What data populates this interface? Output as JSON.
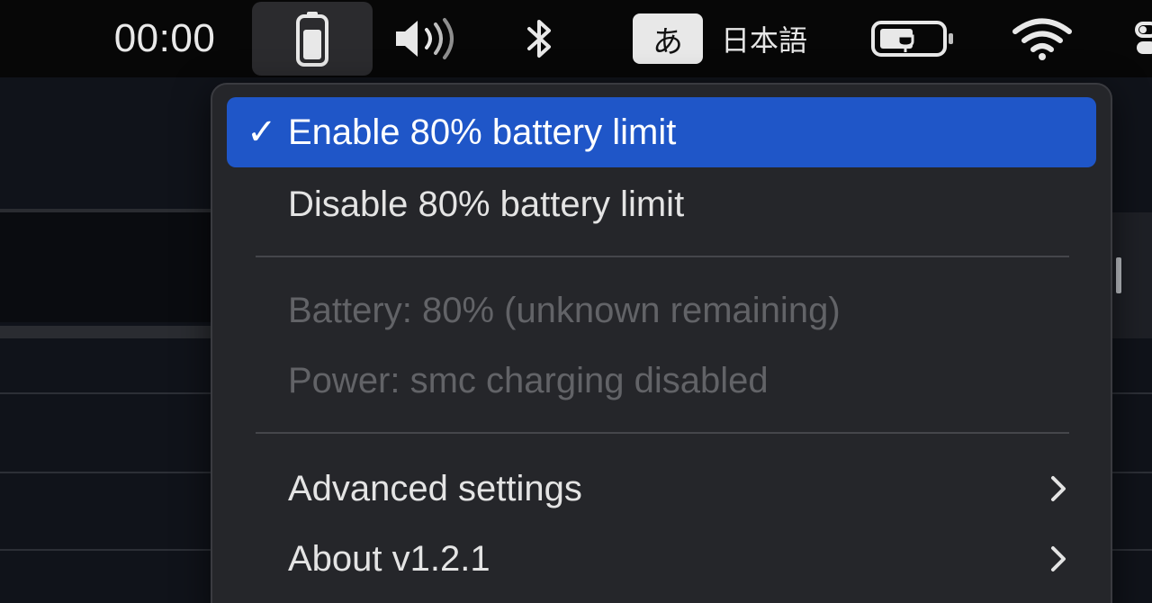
{
  "menubar": {
    "clock": "00:00",
    "input_source": {
      "indicator": "あ",
      "label": "日本語"
    },
    "icons": [
      "battery-app-icon",
      "volume-icon",
      "bluetooth-icon",
      "power-plug-icon",
      "wifi-icon",
      "control-center-icon"
    ]
  },
  "menu": {
    "items": [
      {
        "label": "Enable 80% battery limit",
        "checked": true,
        "selected": true,
        "enabled": true
      },
      {
        "label": "Disable 80% battery limit",
        "checked": false,
        "selected": false,
        "enabled": true
      },
      {
        "label": "Battery: 80% (unknown remaining)",
        "enabled": false
      },
      {
        "label": "Power: smc charging disabled",
        "enabled": false
      },
      {
        "label": "Advanced settings",
        "submenu": true,
        "enabled": true
      },
      {
        "label": "About v1.2.1",
        "submenu": true,
        "enabled": true
      }
    ],
    "check_glyph": "✓"
  },
  "colors": {
    "menubar_bg": "#070707",
    "menu_bg": "#25262a",
    "selection": "#1f56c8",
    "disabled_text": "#626367"
  }
}
